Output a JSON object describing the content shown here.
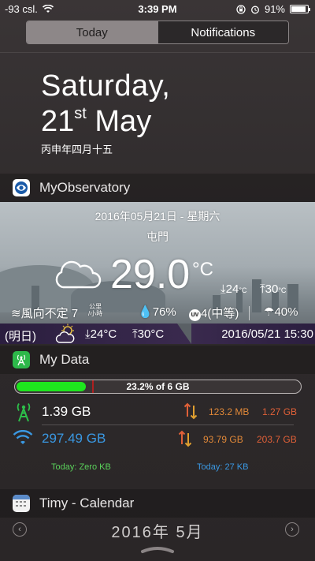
{
  "status": {
    "signal": "-93 csl.",
    "time": "3:39 PM",
    "battery_pct": "91%",
    "battery_level": 0.91,
    "icons": [
      "wifi-icon",
      "orientation-lock-icon",
      "alarm-icon",
      "battery-icon"
    ]
  },
  "tabs": [
    {
      "label": "Today",
      "active": true
    },
    {
      "label": "Notifications",
      "active": false
    }
  ],
  "date": {
    "weekday": "Saturday,",
    "day": "21",
    "suffix": "st",
    "month": "May",
    "lunar": "丙申年四月十五"
  },
  "observatory": {
    "header": "MyObservatory",
    "date_line": "2016年05月21日 - 星期六",
    "location": "屯門",
    "temperature": "29.0",
    "unit": "°C",
    "low": "24",
    "high": "30",
    "wind": "風向不定 7",
    "wind_unit_top": "公里",
    "wind_unit_bottom": "/小時",
    "humidity": "76%",
    "uv_badge": "UV",
    "uv": "4(中等)",
    "rain": "40%",
    "forecast": {
      "label": "(明日)",
      "low": "24°C",
      "high": "30°C",
      "stamp": "2016/05/21 15:30"
    }
  },
  "mydata": {
    "header": "My Data",
    "usage_text": "23.2% of 6 GB",
    "usage_fraction": 0.232,
    "cellular": {
      "total": "1.39 GB",
      "down": "123.2 MB",
      "up": "1.27 GB"
    },
    "wifi": {
      "total": "297.49 GB",
      "down": "93.79 GB",
      "up": "203.7 GB"
    },
    "today_cell": "Today: Zero KB",
    "today_wifi": "Today: 27 KB"
  },
  "calendar": {
    "header": "Timy - Calendar",
    "year": "2016年",
    "month": "5月"
  },
  "colors": {
    "accent_green": "#1ee61e",
    "wifi_blue": "#3a98e2",
    "cell_green": "#5ad05a",
    "traffic_orange": "#e08838"
  }
}
